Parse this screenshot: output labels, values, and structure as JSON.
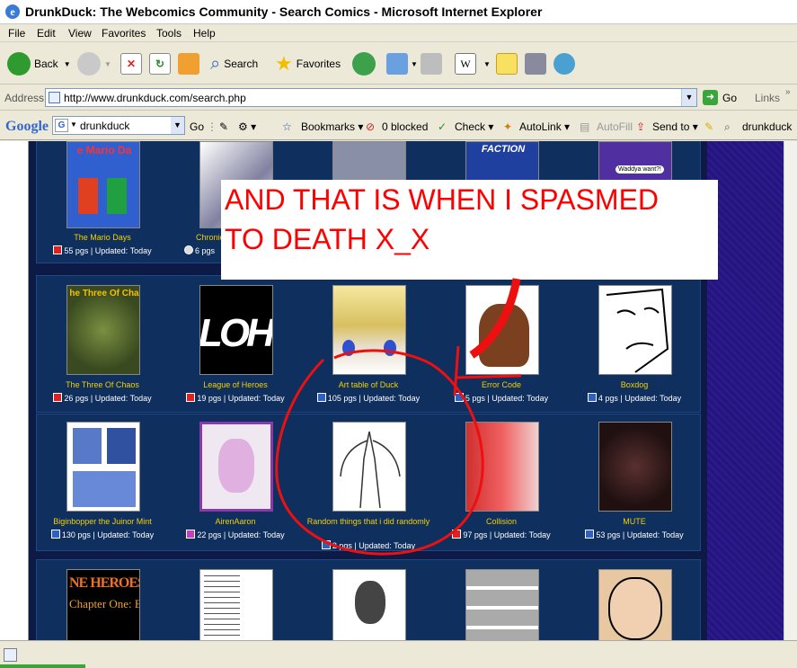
{
  "window": {
    "title": "DrunkDuck: The Webcomics Community - Search Comics - Microsoft Internet Explorer"
  },
  "menu": [
    "File",
    "Edit",
    "View",
    "Favorites",
    "Tools",
    "Help"
  ],
  "toolbar": {
    "back": "Back",
    "search": "Search",
    "favorites": "Favorites"
  },
  "address": {
    "label": "Address",
    "url": "http://www.drunkduck.com/search.php",
    "go": "Go",
    "links": "Links"
  },
  "googlebar": {
    "logo": "Google",
    "query": "drunkduck",
    "go": "Go",
    "bookmarks": "Bookmarks",
    "blocked": "0 blocked",
    "check": "Check",
    "autolink": "AutoLink",
    "autofill": "AutoFill",
    "sendto": "Send to",
    "term": "drunkduck"
  },
  "caption": {
    "line1": "AND THAT IS WHEN I SPASMED",
    "line2": "TO DEATH X_X"
  },
  "comics": [
    {
      "title": "The Mario Days",
      "info": "55 pgs | Updated: Today"
    },
    {
      "title": "Chronic",
      "info": "6 pgs"
    },
    {
      "title": "The Three Of Chaos",
      "info": "26 pgs | Updated: Today"
    },
    {
      "title": "League of Heroes",
      "info": "19 pgs | Updated: Today"
    },
    {
      "title": "Art table of Duck",
      "info": "105 pgs | Updated: Today"
    },
    {
      "title": "Error Code",
      "info": "5 pgs | Updated: Today"
    },
    {
      "title": "Boxdog",
      "info": "4 pgs | Updated: Today"
    },
    {
      "title": "Biginbopper the Juinor Mint",
      "info": "130 pgs | Updated: Today"
    },
    {
      "title": "AirenAaron",
      "info": "22 pgs | Updated: Today"
    },
    {
      "title": "Random things that i did randomly",
      "info": "2 pgs | Updated: Today"
    },
    {
      "title": "Collision",
      "info": "97 pgs | Updated: Today"
    },
    {
      "title": "MUTE",
      "info": "53 pgs | Updated: Today"
    }
  ],
  "thumb_text": {
    "mario": "e Mario Da",
    "faction": "FACTION",
    "waddya": "Waddya want?!",
    "chaos": "he Three Of Cha",
    "loh": "LOH",
    "nineheroes1": "NE HEROES",
    "nineheroes2": "Chapter One: Begin"
  }
}
